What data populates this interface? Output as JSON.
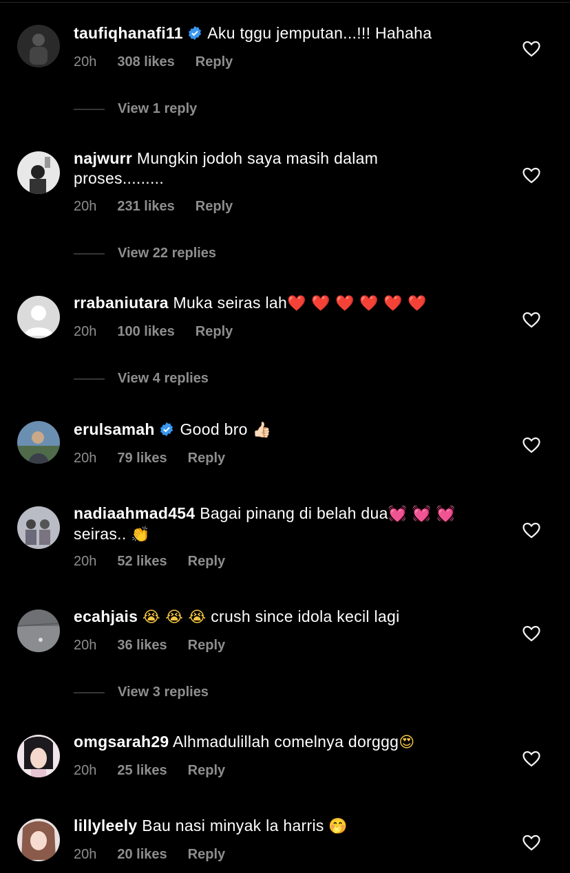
{
  "comments": [
    {
      "username": "taufiqhanafi11",
      "verified": true,
      "text": "Aku tggu jemputan...!!! Hahaha",
      "text2": "",
      "emoji": "",
      "time": "20h",
      "likes": "308 likes",
      "reply": "Reply"
    },
    {
      "username": "najwurr",
      "verified": false,
      "text": "Mungkin jodoh saya masih dalam",
      "text2": "proses.........",
      "emoji": "",
      "time": "20h",
      "likes": "231 likes",
      "reply": "Reply"
    },
    {
      "username": "rrabaniutara",
      "verified": false,
      "text": "Muka seiras lah",
      "text2": "",
      "emoji": "❤️ ❤️ ❤️ ❤️ ❤️ ❤️",
      "time": "20h",
      "likes": "100 likes",
      "reply": "Reply"
    },
    {
      "username": "erulsamah",
      "verified": true,
      "text": "Good bro",
      "text2": "",
      "emoji": "👍🏻",
      "time": "20h",
      "likes": "79 likes",
      "reply": "Reply"
    },
    {
      "username": "nadiaahmad454",
      "verified": false,
      "text": "Bagai pinang di belah dua",
      "text2": "seiras..",
      "emoji": "💓 💓 💓",
      "emoji2": "👏",
      "time": "20h",
      "likes": "52 likes",
      "reply": "Reply"
    },
    {
      "username": "ecahjais",
      "verified": false,
      "text": "crush since idola kecil lagi",
      "text2": "",
      "emoji": "😭 😭 😭",
      "time": "20h",
      "likes": "36 likes",
      "reply": "Reply"
    },
    {
      "username": "omgsarah29",
      "verified": false,
      "text": "Alhmadulillah  comelnya dorggg",
      "text2": "",
      "emoji": "😍",
      "time": "20h",
      "likes": "25 likes",
      "reply": "Reply"
    },
    {
      "username": "lillyleely",
      "verified": false,
      "text": "Bau nasi minyak la harris",
      "text2": "",
      "emoji": "🤭",
      "time": "20h",
      "likes": "20 likes",
      "reply": "Reply"
    }
  ],
  "view_replies": [
    "View 1 reply",
    "View 22 replies",
    "View 4 replies",
    "View 3 replies"
  ],
  "icons": {
    "like": "heart-outline-icon",
    "verified": "verified-badge-icon"
  },
  "colors": {
    "background": "#000000",
    "secondary_text": "#8e8e8e",
    "verified": "#3897f0"
  }
}
